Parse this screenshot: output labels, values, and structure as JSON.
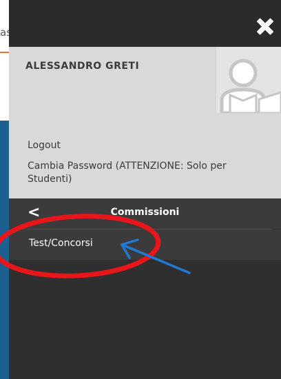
{
  "background_page": {
    "partial_text": "as"
  },
  "drawer": {
    "close_icon": "close-icon",
    "user": {
      "name": "ALESSANDRO GRETI",
      "avatar_icon": "user-avatar-icon"
    },
    "links": [
      {
        "label": "Logout"
      },
      {
        "label": "Cambia Password (ATTENZIONE: Solo per Studenti)"
      }
    ],
    "section": {
      "back_icon": "chevron-left-icon",
      "back_glyph": "<",
      "title": "Commissioni"
    },
    "menu": [
      {
        "label": "Test/Concorsi"
      }
    ]
  },
  "colors": {
    "drawer_bg": "#333333",
    "profile_bg": "#d9d9d9",
    "annotation_red": "#e8161b",
    "annotation_blue": "#1f7ad6"
  }
}
